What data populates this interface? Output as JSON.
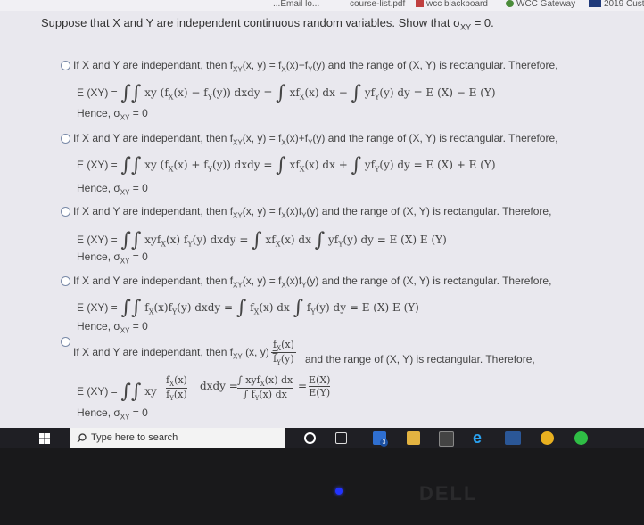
{
  "browser": {
    "bookmarks": [
      "wcc blackboard",
      "WCC Gateway",
      "2019 Cust"
    ],
    "partial_tab": "course-list.pdf",
    "partial_left": "...Email lo..."
  },
  "question": "Suppose that X and Y are independent continuous random variables. Show that σ",
  "question_sub": "XY",
  "question_end": " = 0.",
  "options": [
    {
      "intro": "If X and Y are independant, then f",
      "sub": "XY",
      "rel": "(x, y) = f",
      "sub2": "X",
      "rel2": "(x)−f",
      "sub3": "Y",
      "rel3": "(y) and the range of (X, Y) is rectangular. Therefore,",
      "eq_lhs": "E (XY) =",
      "eq_body": "xy (f",
      "eq_mid": "(x) − f",
      "eq_end": "(y)) dxdy =",
      "eq_r1": "xf",
      "eq_r1b": "(x) dx −",
      "eq_r2": "yf",
      "eq_r2b": "(y) dy = E (X) − E (Y)",
      "hence": "Hence, σ",
      "hence_sub": "XY",
      "hence_end": " = 0"
    },
    {
      "intro": "If X and Y are independant, then f",
      "sub": "XY",
      "rel": "(x, y) = f",
      "sub2": "X",
      "rel2": "(x)+f",
      "sub3": "Y",
      "rel3": "(y) and the range of (X, Y) is rectangular. Therefore,",
      "eq_lhs": "E (XY) =",
      "eq_body": "xy (f",
      "eq_mid": "(x) + f",
      "eq_end": "(y)) dxdy =",
      "eq_r1": "xf",
      "eq_r1b": "(x) dx +",
      "eq_r2": "yf",
      "eq_r2b": "(y) dy = E (X) + E (Y)",
      "hence": "Hence, σ",
      "hence_sub": "XY",
      "hence_end": " = 0"
    },
    {
      "intro": "If X and Y are independant, then f",
      "sub": "XY",
      "rel": "(x, y) = f",
      "sub2": "X",
      "rel2": "(x)f",
      "sub3": "Y",
      "rel3": "(y) and the range of (X, Y) is rectangular. Therefore,",
      "eq_lhs": "E (XY) =",
      "eq_body": "xyf",
      "eq_mid": "(x) f",
      "eq_end": "(y) dxdy =",
      "eq_r1": "xf",
      "eq_r1b": "(x) dx",
      "eq_r2": "yf",
      "eq_r2b": "(y) dy = E (X) E (Y)",
      "hence": "Hence, σ",
      "hence_sub": "XY",
      "hence_end": " = 0"
    },
    {
      "intro": "If X and Y are independant, then f",
      "sub": "XY",
      "rel": "(x, y) = f",
      "sub2": "X",
      "rel2": "(x)f",
      "sub3": "Y",
      "rel3": "(y) and the range of (X, Y) is rectangular. Therefore,",
      "eq_lhs": "E (XY) =",
      "eq_body": "f",
      "eq_mid": "(x)f",
      "eq_end": "(y) dxdy =",
      "eq_r1": "f",
      "eq_r1b": "(x) dx",
      "eq_r2": "f",
      "eq_r2b": "(y) dy = E (X) E (Y)",
      "hence": "Hence, σ",
      "hence_sub": "XY",
      "hence_end": " = 0"
    },
    {
      "intro": "If X and Y are independant, then f",
      "sub": "XY",
      "rel": "(x, y) =",
      "frac_num": "f",
      "frac_num_sub": "X",
      "frac_num_end": "(x)",
      "frac_den": "f",
      "frac_den_sub": "Y",
      "frac_den_end": "(y)",
      "rel3": "and the range of (X, Y) is rectangular. Therefore,",
      "eq_lhs": "E (XY) =",
      "eq_body": "xy",
      "eq_end": "dxdy =",
      "eq_rnum": "∫ xyf",
      "eq_rnum_end": "(x) dx",
      "eq_rden": "∫ f",
      "eq_rden_end": "(x) dx",
      "eq_final_num": "E(X)",
      "eq_final_den": "E(Y)",
      "hence": "Hence, σ",
      "hence_sub": "XY",
      "hence_end": " = 0"
    }
  ],
  "taskbar": {
    "search_placeholder": "Type here to search",
    "mail_badge": "3"
  },
  "bezel_brand": "DELL",
  "colors": {
    "screen_bg": "#e9e8ee",
    "taskbar": "#1f1f24",
    "radio_border": "#7a8aa8"
  }
}
